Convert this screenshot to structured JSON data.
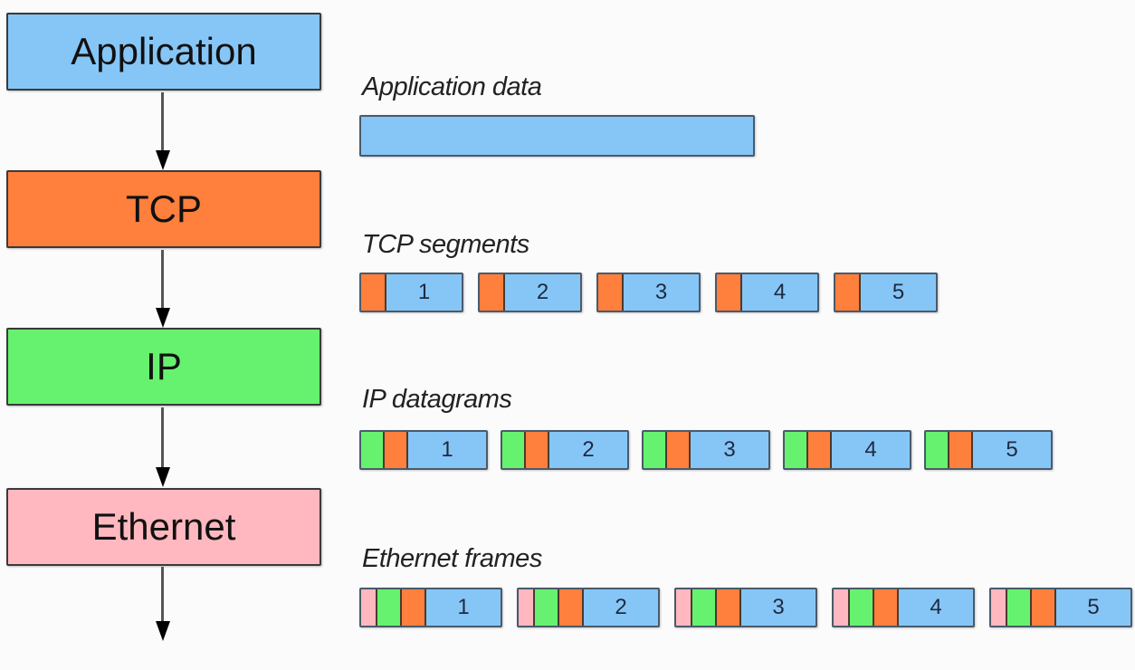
{
  "colors": {
    "application": "#86c6f7",
    "tcp": "#ff7f3c",
    "ip": "#66f26e",
    "ethernet": "#ffb8bf"
  },
  "layers": [
    {
      "label": "Application",
      "key": "application"
    },
    {
      "label": "TCP",
      "key": "tcp"
    },
    {
      "label": "IP",
      "key": "ip"
    },
    {
      "label": "Ethernet",
      "key": "ethernet"
    }
  ],
  "sections": {
    "application": {
      "label": "Application data"
    },
    "tcp": {
      "label": "TCP segments",
      "packets": [
        "1",
        "2",
        "3",
        "4",
        "5"
      ],
      "headers": [
        "tcp"
      ]
    },
    "ip": {
      "label": "IP datagrams",
      "packets": [
        "1",
        "2",
        "3",
        "4",
        "5"
      ],
      "headers": [
        "ip",
        "tcp"
      ]
    },
    "ethernet": {
      "label": "Ethernet frames",
      "packets": [
        "1",
        "2",
        "3",
        "4",
        "5"
      ],
      "headers": [
        "ethernet",
        "ip",
        "tcp"
      ]
    }
  }
}
